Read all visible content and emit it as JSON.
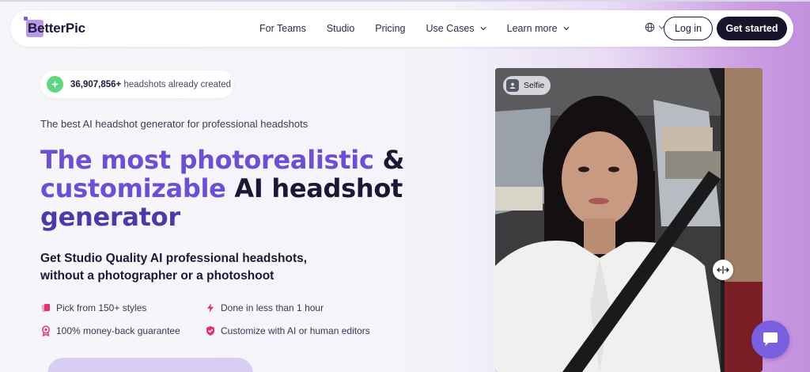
{
  "nav": {
    "logo": "BetterPic",
    "links": [
      {
        "label": "For Teams",
        "dropdown": false
      },
      {
        "label": "Studio",
        "dropdown": false
      },
      {
        "label": "Pricing",
        "dropdown": false
      },
      {
        "label": "Use Cases",
        "dropdown": true
      },
      {
        "label": "Learn more",
        "dropdown": true
      }
    ],
    "language_icon": "globe-icon",
    "login_label": "Log in",
    "cta_label": "Get started"
  },
  "hero": {
    "counter_value": "36,907,856+",
    "counter_text": " headshots already created",
    "subtitle": "The best AI headshot generator for professional headshots",
    "headline_part1": "The most photorealistic",
    "headline_amp": " &",
    "headline_part2": "customizable",
    "headline_part3": " AI headshot",
    "headline_part4": "generator",
    "tagline_line1": "Get Studio Quality AI professional headshots,",
    "tagline_line2": "without a photographer or a photoshoot",
    "features": [
      {
        "label": "Pick from 150+ styles",
        "icon": "styles-icon"
      },
      {
        "label": "Done in less than 1 hour",
        "icon": "lightning-icon"
      },
      {
        "label": "100% money-back guarantee",
        "icon": "guarantee-badge-icon"
      },
      {
        "label": "Customize with AI or human editors",
        "icon": "shield-icon"
      }
    ],
    "image_badge": "Selfie"
  },
  "colors": {
    "accent": "#6d4fd4",
    "dark": "#17152c",
    "feature_icon": "#e0336f",
    "counter_icon": "#5fd67f",
    "chat_button": "#7a5fe0"
  }
}
